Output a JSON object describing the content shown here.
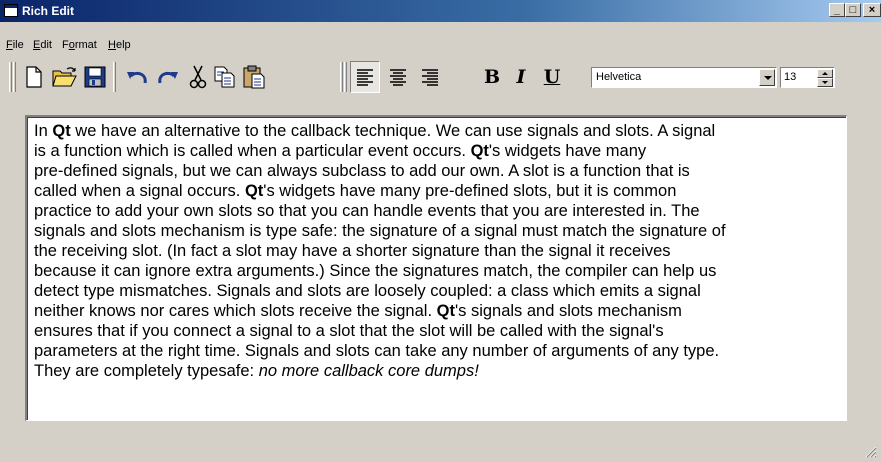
{
  "window": {
    "title": "Rich Edit",
    "caption_buttons": [
      "_",
      "□",
      "×"
    ]
  },
  "menu": [
    {
      "accel": "F",
      "rest": "ile"
    },
    {
      "accel": "E",
      "rest": "dit"
    },
    {
      "pre": "F",
      "accel": "o",
      "rest": "rmat"
    },
    {
      "accel": "H",
      "rest": "elp"
    }
  ],
  "toolbar": {
    "icons": [
      "new-file-icon",
      "open-folder-icon",
      "save-icon",
      "undo-icon",
      "redo-icon",
      "cut-icon",
      "copy-icon",
      "paste-icon",
      "align-left-icon",
      "align-center-icon",
      "align-right-icon"
    ],
    "bold_label": "B",
    "italic_label": "I",
    "underline_label": "U",
    "font_family": "Helvetica",
    "font_size": "13"
  },
  "editor": {
    "lines": [
      [
        {
          "t": "In "
        },
        {
          "t": "Qt",
          "b": true
        },
        {
          "t": " we have an alternative to the callback technique. We can use signals and slots. A signal"
        }
      ],
      [
        {
          "t": "is a function which is called when a particular event occurs. "
        },
        {
          "t": "Qt",
          "b": true
        },
        {
          "t": "'s widgets have many"
        }
      ],
      [
        {
          "t": "pre-defined signals, but we can always subclass to add our own. A slot is a function that is"
        }
      ],
      [
        {
          "t": "called when a signal occurs. "
        },
        {
          "t": "Qt",
          "b": true
        },
        {
          "t": "'s widgets have many pre-defined slots, but it is common"
        }
      ],
      [
        {
          "t": "practice to add your own slots so that you can handle events that you are interested in. The"
        }
      ],
      [
        {
          "t": "signals and slots mechanism is type safe: the signature of a signal must match the signature of"
        }
      ],
      [
        {
          "t": "the receiving slot. (In fact a slot may have a shorter signature than the signal it receives"
        }
      ],
      [
        {
          "t": "because it can ignore extra arguments.) Since the signatures match, the compiler can help us"
        }
      ],
      [
        {
          "t": "detect type mismatches. Signals and slots are loosely coupled: a class which emits a signal"
        }
      ],
      [
        {
          "t": "neither knows nor cares which slots receive the signal. "
        },
        {
          "t": "Qt",
          "b": true
        },
        {
          "t": "'s signals and slots mechanism"
        }
      ],
      [
        {
          "t": "ensures that if you connect a signal to a slot that the slot will be called with the signal's"
        }
      ],
      [
        {
          "t": "parameters at the right time. Signals and slots can take any number of arguments of any type."
        }
      ],
      [
        {
          "t": "They are completely typesafe: "
        },
        {
          "t": "no more callback core dumps!",
          "i": true
        }
      ]
    ]
  }
}
